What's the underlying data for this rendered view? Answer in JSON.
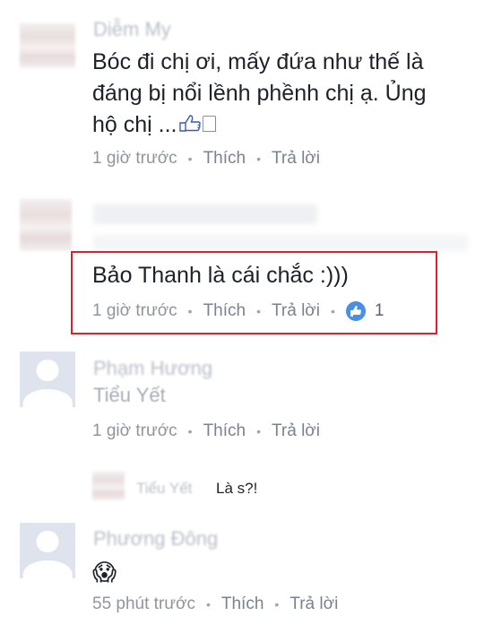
{
  "comments": [
    {
      "name": "Diễm My",
      "text_line1": "Bóc đi chị ơi, mấy đứa như thế là",
      "text_line2": "đáng bị nổi lềnh phềnh chị ạ. Ủng",
      "text_line3": "hộ chị ...",
      "box_glyph": "🗌",
      "time": "1 giờ trước",
      "like_label": "Thích",
      "reply_label": "Trả lời"
    },
    {
      "text": "Bảo Thanh là cái chắc :)))",
      "time": "1 giờ trước",
      "like_label": "Thích",
      "reply_label": "Trả lời",
      "reaction_count": "1"
    },
    {
      "name_line1": "Phạm Hương",
      "name_line2": "Tiểu Yết",
      "time": "1 giờ trước",
      "like_label": "Thích",
      "reply_label": "Trả lời"
    },
    {
      "name": "Phương Đông",
      "emoji": "😱",
      "time": "55 phút trước",
      "like_label": "Thích",
      "reply_label": "Trả lời"
    }
  ],
  "reply": {
    "name": "Tiểu Yết",
    "text": "Là s?!"
  },
  "colors": {
    "highlight_border": "#d9222a",
    "reaction_blue": "#4a90e2",
    "meta_gray": "#90949c"
  }
}
